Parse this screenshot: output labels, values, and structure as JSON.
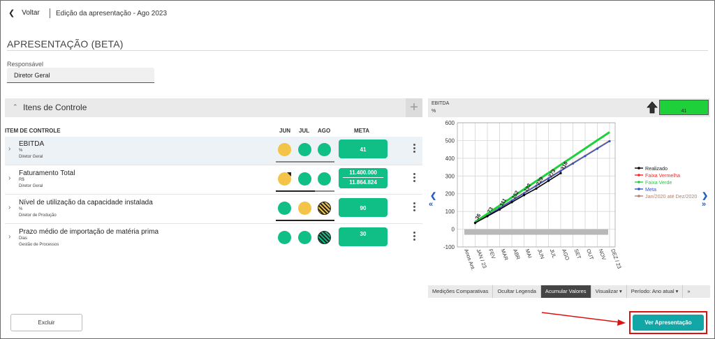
{
  "header": {
    "back_label": "Voltar",
    "breadcrumb": "Edição da apresentação - Ago 2023"
  },
  "page_title": "APRESENTAÇÃO (BETA)",
  "responsavel": {
    "label": "Responsável",
    "value": "Diretor Geral"
  },
  "panel": {
    "title": "Itens de Controle",
    "add_label": "+"
  },
  "columns": {
    "item": "ITEM DE CONTROLE",
    "jun": "JUN",
    "jul": "JUL",
    "ago": "AGO",
    "meta": "META"
  },
  "rows": [
    {
      "name": "EBITDA",
      "unit": "%",
      "owner": "Diretor Geral",
      "meta": "41",
      "status": [
        "yellow",
        "green",
        "green"
      ]
    },
    {
      "name": "Faturamento Total",
      "unit": "R$",
      "owner": "Diretor Geral",
      "meta_top": "11.400.000",
      "meta_bottom": "11.864.824",
      "status": [
        "yellow",
        "green",
        "green"
      ]
    },
    {
      "name": "Nível de utilização da capacidade instalada",
      "unit": "%",
      "owner": "Diretor de Produção",
      "meta": "90",
      "status": [
        "green",
        "yellow",
        "striped-yellow"
      ]
    },
    {
      "name": "Prazo médio de importação de matéria prima",
      "unit": "Dias",
      "owner": "Gestão de Processos",
      "meta": "30",
      "status": [
        "green",
        "green",
        "striped-green"
      ]
    }
  ],
  "chart_header": {
    "title": "EBITDA",
    "unit": "%",
    "score": "41",
    "trend_icon": "arrow-up-icon"
  },
  "chart_data": {
    "type": "line",
    "categories": [
      "Anos Ant.",
      "JAN / 23",
      "FEV",
      "MAR",
      "ABR",
      "MAI",
      "JUN",
      "JUL",
      "AGO",
      "SET",
      "OUT",
      "NOV",
      "DEZ / 23"
    ],
    "ylim": [
      -100,
      600
    ],
    "yticks": [
      -100,
      0,
      100,
      200,
      300,
      400,
      500,
      600
    ],
    "grid": true,
    "legend_position": "right",
    "series": [
      {
        "name": "Realizado",
        "color": "#000000",
        "values": [
          null,
          36,
          73,
          111,
          152,
          192,
          229,
          273,
          316,
          null,
          null,
          null,
          null
        ],
        "labels": true
      },
      {
        "name": "Faixa Vermelha",
        "color": "#ff2020",
        "values": [
          null,
          40,
          86,
          132,
          178,
          224,
          270,
          316,
          362,
          408,
          454,
          500,
          546
        ]
      },
      {
        "name": "Faixa Verde",
        "color": "#1ed13a",
        "values": [
          null,
          41,
          87,
          133,
          179,
          225,
          271,
          317,
          363,
          409,
          455,
          501,
          547
        ]
      },
      {
        "name": "Meta",
        "color": "#3050d0",
        "values": [
          null,
          34,
          76,
          118,
          160,
          202,
          244,
          286,
          328,
          370,
          412,
          454,
          496
        ]
      },
      {
        "name": "Jan/2020 até Dez/2020",
        "color": "#b08070",
        "values": [
          null,
          38,
          80,
          122,
          164,
          206,
          248,
          290,
          332,
          374,
          416,
          458,
          500
        ]
      }
    ]
  },
  "chart_toolbar": [
    "Medições Comparativas",
    "Ocultar Legenda",
    "Acumular Valores",
    "Visualizar ▾",
    "Período: Ano atual ▾",
    "»"
  ],
  "footer": {
    "delete_label": "Excluir",
    "view_label": "Ver Apresentação"
  },
  "colors": {
    "accent": "#13a6a6",
    "green": "#0fbf86",
    "yellow": "#f3c447",
    "annotation": "#e01010"
  }
}
